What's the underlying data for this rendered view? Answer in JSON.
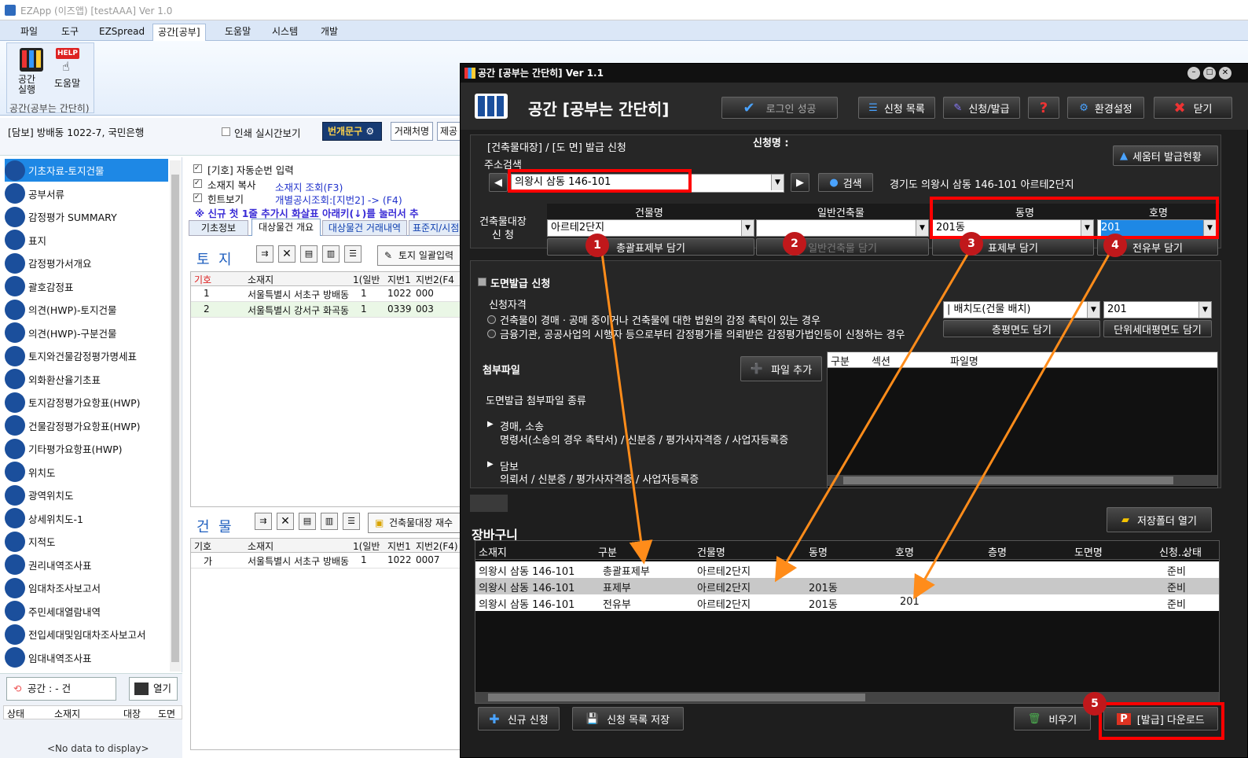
{
  "app": {
    "title": "EZApp (이즈앱) [testAAA] Ver 1.0"
  },
  "ribbon": {
    "tabs": [
      "파일",
      "도구",
      "EZSpread",
      "공간[공부]",
      "도움말",
      "시스템",
      "개발"
    ],
    "group_label": "공간(공부는 간단히)",
    "btn_run": "공간\n실행",
    "btn_help": "도움말",
    "help_badge": "HELP"
  },
  "toolbar": {
    "doc_title": "[담보] 방배동 1022-7, 국민은행",
    "print_check": "인쇄 실시간보기",
    "bungae": "번개문구",
    "tradename": "거래처명",
    "submit": "제공"
  },
  "sidebar": {
    "items": [
      "기초자료-토지건물",
      "공부서류",
      "감정평가 SUMMARY",
      "표지",
      "감정평가서개요",
      "괄호감정표",
      "의견(HWP)-토지건물",
      "의견(HWP)-구분건물",
      "토지와건물감정평가명세표",
      "외화환산율기초표",
      "토지감정평가요항표(HWP)",
      "건물감정평가요항표(HWP)",
      "기타평가요항표(HWP)",
      "위치도",
      "광역위치도",
      "상세위치도-1",
      "지적도",
      "권리내역조사표",
      "임대차조사보고서",
      "주민세대열람내역",
      "전입세대및임대차조사보고서",
      "임대내역조사표"
    ],
    "space_btn": "공간 : - 건",
    "open_btn": "열기",
    "bottom_cols": [
      "상태",
      "소재지",
      "대장",
      "도면"
    ],
    "no_data": "<No data to display>"
  },
  "middle": {
    "check1": "[기호] 자동순번 입력",
    "check2": "소재지 복사",
    "check3": "힌트보기",
    "link1": "소재지 조회(F3)",
    "link2": "개별공시조회:[지번2] -> (F4)",
    "notice": "※ 신규 첫 1줄 추가시 화살표 아래키(↓)를 눌러서 추",
    "tabs": [
      "기초정보",
      "대상물건 개요",
      "대상물건 거래내역",
      "표준지/시점"
    ],
    "land_title": "토  지",
    "land_btn": "토지 일괄입력",
    "land_cols": [
      "기호",
      "소재지",
      "1(일반",
      "지번1",
      "지번2(F4"
    ],
    "land_rows": [
      [
        "1",
        "서울특별시 서초구 방배동",
        "1",
        "1022",
        "000"
      ],
      [
        "2",
        "서울특별시 강서구 화곡동",
        "1",
        "0339",
        "003"
      ]
    ],
    "bld_title": "건  물",
    "bld_btn": "건축물대장 재수",
    "bld_cols": [
      "기호",
      "소재지",
      "1(일반",
      "지번1",
      "지번2(F4)"
    ],
    "bld_rows": [
      [
        "가",
        "서울특별시 서초구 방배동",
        "1",
        "1022",
        "0007"
      ]
    ]
  },
  "win": {
    "title": "공간 [공부는 간단히] Ver 1.1",
    "brand": "공간 [공부는 간단히]",
    "login": "로그인 성공",
    "list_btn": "신청 목록",
    "apply_btn": "신청/발급",
    "help_btn": "?",
    "settings_btn": "환경설정",
    "close_btn": "닫기",
    "apply_header": "[건축물대장]  / [도 면]  발급 신청",
    "applicant": "신청명 :",
    "seumter": "세움터 발급현황",
    "addr_label": "주소검색",
    "addr_value": "의왕시 삼동 146-101",
    "search_btn": "검색",
    "addr_result": "경기도 의왕시 삼동 146-101 아르테2단지",
    "bld_apply_label": "건축물대장\n신 청",
    "col_bldname": "건물명",
    "col_general": "일반건축물",
    "col_dong": "동명",
    "col_ho": "호명",
    "bldname_val": "아르테2단지",
    "dong_val": "201동",
    "ho_val": "201",
    "btn_total": "총괄표제부 담기",
    "btn_general": "일반건축물 담기",
    "btn_title": "표제부 담기",
    "btn_exclusive": "전유부 담기",
    "drawing_apply": "도면발급 신청",
    "qualification": "신청자격",
    "qual1": "건축물이 경매ㆍ공매 중이거나 건축물에 대한 법원의 감정 촉탁이 있는 경우",
    "qual2": "금융기관, 공공사업의 시행자 등으로부터 감정평가를 의뢰받은 감정평가법인등이 신청하는 경우",
    "drawing_type": "| 배치도(건물 배치)",
    "drawing_ho": "201",
    "btn_floor": "층평면도 담기",
    "btn_unit": "단위세대평면도 담기",
    "attach": "첨부파일",
    "add_file": "파일 추가",
    "attach_cols": [
      "구분",
      "섹션",
      "파일명"
    ],
    "attach_kinds": "도면발급 첨부파일 종류",
    "auction_title": "경매, 소송",
    "auction_docs": "명령서(소송의 경우 촉탁서) / 신분증 / 평가사자격증 / 사업자등록증",
    "mortgage_title": "담보",
    "mortgage_docs": "의뢰서 / 신분증 / 평가사자격증 / 사업자등록증",
    "basket": "장바구니",
    "save_folder": "저장폴더 열기",
    "basket_cols": [
      "소재지",
      "구분",
      "건물명",
      "동명",
      "호명",
      "층명",
      "도면명",
      "신청...",
      "상태"
    ],
    "basket_rows": [
      [
        "의왕시 삼동 146-101",
        "총괄표제부",
        "아르테2단지",
        "",
        "",
        "",
        "",
        "",
        "준비"
      ],
      [
        "의왕시 삼동 146-101",
        "표제부",
        "아르테2단지",
        "201동",
        "",
        "",
        "",
        "",
        "준비"
      ],
      [
        "의왕시 삼동 146-101",
        "전유부",
        "아르테2단지",
        "201동",
        "201",
        "",
        "",
        "",
        "준비"
      ]
    ],
    "new_btn": "신규 신청",
    "save_list_btn": "신청 목록 저장",
    "clear_btn": "비우기",
    "download_btn": "[발급] 다운로드"
  },
  "callouts": [
    "1",
    "2",
    "3",
    "4",
    "5"
  ],
  "colors": {
    "accent_red": "#ff0000",
    "arrow": "#ff8c1a",
    "selection": "#1e88e5"
  }
}
